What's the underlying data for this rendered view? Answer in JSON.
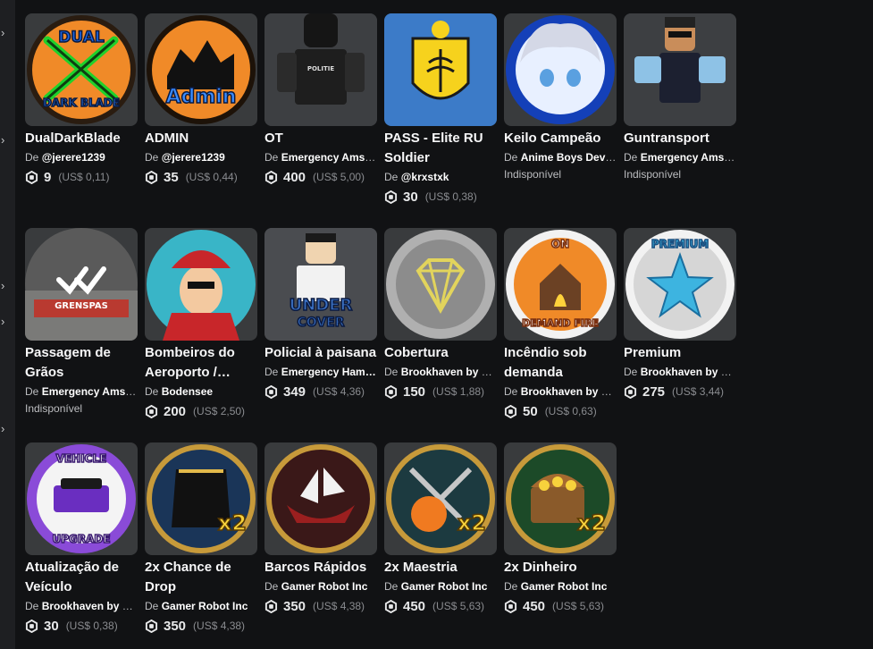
{
  "colors": {
    "background": "#111214",
    "card": "#393b3d",
    "text": "#ffffff",
    "muted": "#bdbec1"
  },
  "by_prefix": "De",
  "items": [
    {
      "name": "DualDarkBlade",
      "creator": "@jerere1239",
      "price": "9",
      "usd": "(US$ 0,11)",
      "art": "dual-dark-blade"
    },
    {
      "name": "ADMIN",
      "creator": "@jerere1239",
      "price": "35",
      "usd": "(US$ 0,44)",
      "art": "admin"
    },
    {
      "name": "OT",
      "creator": "Emergency Amst…",
      "price": "400",
      "usd": "(US$ 5,00)",
      "art": "police-avatar"
    },
    {
      "name": "PASS - Elite RU Soldier",
      "creator": "@krxstxk",
      "price": "30",
      "usd": "(US$ 0,38)",
      "art": "coat-of-arms"
    },
    {
      "name": "Keilo Campeão",
      "creator": "Anime Boys Deve…",
      "unavailable": "Indisponível",
      "art": "anime-face"
    },
    {
      "name": "Guntransport",
      "creator": "Emergency Amst…",
      "unavailable": "Indisponível",
      "art": "sunglasses-avatar"
    },
    {
      "name": "Passagem de Grãos",
      "creator": "Emergency Amst…",
      "unavailable": "Indisponível",
      "art": "grenspas",
      "art_text": "GRENSPAS"
    },
    {
      "name": "Bombeiros do Aeroporto /…",
      "creator": "Bodensee",
      "price": "200",
      "usd": "(US$ 2,50)",
      "art": "firefighter"
    },
    {
      "name": "Policial à paisana",
      "creator": "Emergency Ham…",
      "price": "349",
      "usd": "(US$ 4,36)",
      "art": "undercover",
      "art_text": "UNDER COVER"
    },
    {
      "name": "Cobertura",
      "creator": "Brookhaven by V…",
      "price": "150",
      "usd": "(US$ 1,88)",
      "art": "diamond"
    },
    {
      "name": "Incêndio sob demanda",
      "creator": "Brookhaven by V…",
      "price": "50",
      "usd": "(US$ 0,63)",
      "art": "on-demand-fire",
      "art_text": "ON DEMAND FIRE"
    },
    {
      "name": "Premium",
      "creator": "Brookhaven by V…",
      "price": "275",
      "usd": "(US$ 3,44)",
      "art": "premium-star",
      "art_text": "PREMIUM"
    },
    {
      "name": "Atualização de Veículo",
      "creator": "Brookhaven by V…",
      "price": "30",
      "usd": "(US$ 0,38)",
      "art": "vehicle-upgrade",
      "art_text": "VEHICLE UPGRADE"
    },
    {
      "name": "2x Chance de Drop",
      "creator": "Gamer Robot Inc",
      "price": "350",
      "usd": "(US$ 4,38)",
      "art": "x2-cape",
      "art_text": "x2"
    },
    {
      "name": "Barcos Rápidos",
      "creator": "Gamer Robot Inc",
      "price": "350",
      "usd": "(US$ 4,38)",
      "art": "boat"
    },
    {
      "name": "2x Maestria",
      "creator": "Gamer Robot Inc",
      "price": "450",
      "usd": "(US$ 5,63)",
      "art": "x2-swords",
      "art_text": "x2"
    },
    {
      "name": "2x Dinheiro",
      "creator": "Gamer Robot Inc",
      "price": "450",
      "usd": "(US$ 5,63)",
      "art": "x2-treasure",
      "art_text": "x2"
    }
  ]
}
